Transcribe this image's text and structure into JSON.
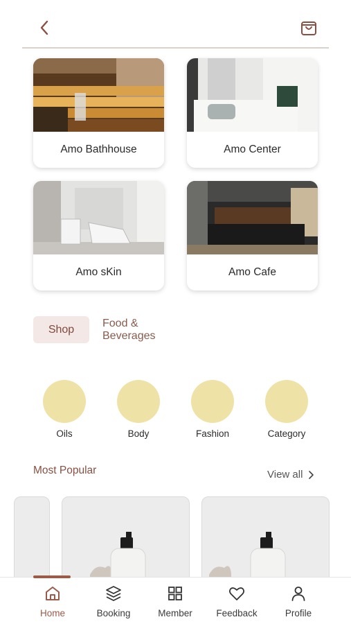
{
  "colors": {
    "accent": "#9c5a48",
    "tab_bg": "#f3e8e5",
    "category_circle": "#efe2a6"
  },
  "header": {
    "back_icon": "chevron-left-icon",
    "cart_icon": "shopping-bag-icon"
  },
  "venues": [
    {
      "label": "Amo Bathhouse"
    },
    {
      "label": "Amo Center"
    },
    {
      "label": "Amo sKin"
    },
    {
      "label": "Amo Cafe"
    }
  ],
  "tabs": [
    {
      "label": "Shop",
      "selected": true
    },
    {
      "label": "Food & Beverages",
      "selected": false
    }
  ],
  "categories": [
    {
      "label": "Oils"
    },
    {
      "label": "Body"
    },
    {
      "label": "Fashion"
    },
    {
      "label": "Category"
    }
  ],
  "most_popular": {
    "title": "Most Popular",
    "view_all": "View all"
  },
  "bottom_nav": [
    {
      "label": "Home",
      "icon": "home-icon",
      "active": true
    },
    {
      "label": "Booking",
      "icon": "layers-icon",
      "active": false
    },
    {
      "label": "Member",
      "icon": "grid-icon",
      "active": false
    },
    {
      "label": "Feedback",
      "icon": "heart-icon",
      "active": false
    },
    {
      "label": "Profile",
      "icon": "user-icon",
      "active": false
    }
  ]
}
